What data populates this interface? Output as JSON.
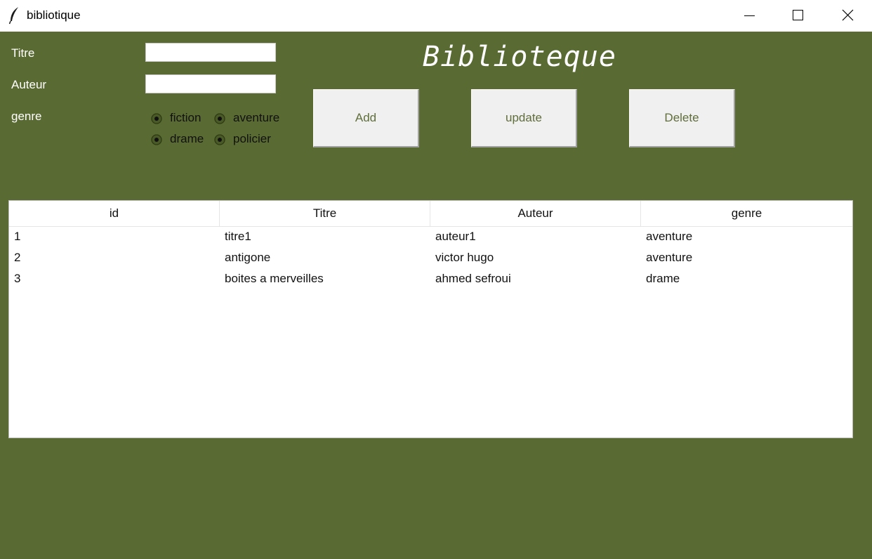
{
  "window": {
    "title": "bibliotique",
    "icon": "feather-icon",
    "controls": [
      "minimize-icon",
      "maximize-icon",
      "close-icon"
    ]
  },
  "colors": {
    "background": "#596a32",
    "button_text": "#5f6e3a",
    "button_face": "#f0f0f0"
  },
  "form": {
    "titre_label": "Titre",
    "titre_value": "",
    "auteur_label": "Auteur",
    "auteur_value": "",
    "genre_label": "genre",
    "genres": [
      {
        "label": "fiction"
      },
      {
        "label": "aventure"
      },
      {
        "label": "drame"
      },
      {
        "label": "policier"
      }
    ]
  },
  "heading": "Biblioteque",
  "buttons": {
    "add": "Add",
    "update": "update",
    "delete": "Delete"
  },
  "table": {
    "columns": [
      "id",
      "Titre",
      "Auteur",
      "genre"
    ],
    "rows": [
      [
        "1",
        "titre1",
        "auteur1",
        "aventure"
      ],
      [
        "2",
        "antigone",
        "victor hugo",
        "aventure"
      ],
      [
        "3",
        "boites a merveilles",
        "ahmed sefroui",
        "drame"
      ]
    ]
  }
}
